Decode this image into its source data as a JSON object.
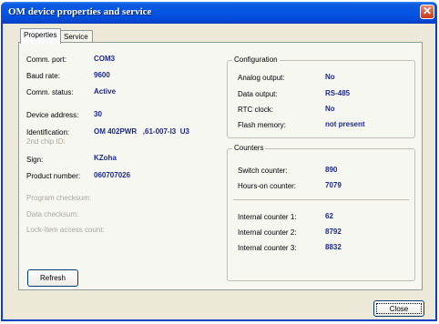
{
  "window": {
    "title": "OM device properties and service",
    "close_glyph": "✕"
  },
  "tabs": [
    {
      "label": "Properties"
    },
    {
      "label": "Service"
    }
  ],
  "properties": {
    "comm_port": {
      "label": "Comm. port:",
      "value": "COM3"
    },
    "baud_rate": {
      "label": "Baud rate:",
      "value": "9600"
    },
    "comm_status": {
      "label": "Comm. status:",
      "value": "Active"
    },
    "device_address": {
      "label": "Device address:",
      "value": "30"
    },
    "identification": {
      "label": "Identification:",
      "value": "OM 402PWR   ,61-007-I3  U3"
    },
    "second_chip_id": {
      "label": "2nd chip ID:"
    },
    "sign": {
      "label": "Sign:",
      "value": "KZoha"
    },
    "product_number": {
      "label": "Product number:",
      "value": "060707026"
    },
    "program_checksum": {
      "label": "Program checksum:"
    },
    "data_checksum": {
      "label": "Data checksum:"
    },
    "lock_item_access_count": {
      "label": "Lock-item access count:"
    }
  },
  "configuration": {
    "title": "Configuration",
    "analog_output": {
      "label": "Analog output:",
      "value": "No"
    },
    "data_output": {
      "label": "Data output:",
      "value": "RS-485"
    },
    "rtc_clock": {
      "label": "RTC clock:",
      "value": "No"
    },
    "flash_memory": {
      "label": "Flash memory:",
      "value": "not present"
    }
  },
  "counters": {
    "title": "Counters",
    "switch_counter": {
      "label": "Switch counter:",
      "value": "890"
    },
    "hours_on_counter": {
      "label": "Hours-on counter:",
      "value": "7079"
    },
    "internal_counter_1": {
      "label": "Internal counter 1:",
      "value": "62"
    },
    "internal_counter_2": {
      "label": "Internal counter 2:",
      "value": "8792"
    },
    "internal_counter_3": {
      "label": "Internal counter 3:",
      "value": "8832"
    }
  },
  "buttons": {
    "refresh": "Refresh",
    "close": "Close"
  },
  "colors": {
    "title_bar": "#0554e3",
    "value_text": "#1b2a8a",
    "dialog_bg": "#ece9d8",
    "close_button": "#c7391a"
  }
}
